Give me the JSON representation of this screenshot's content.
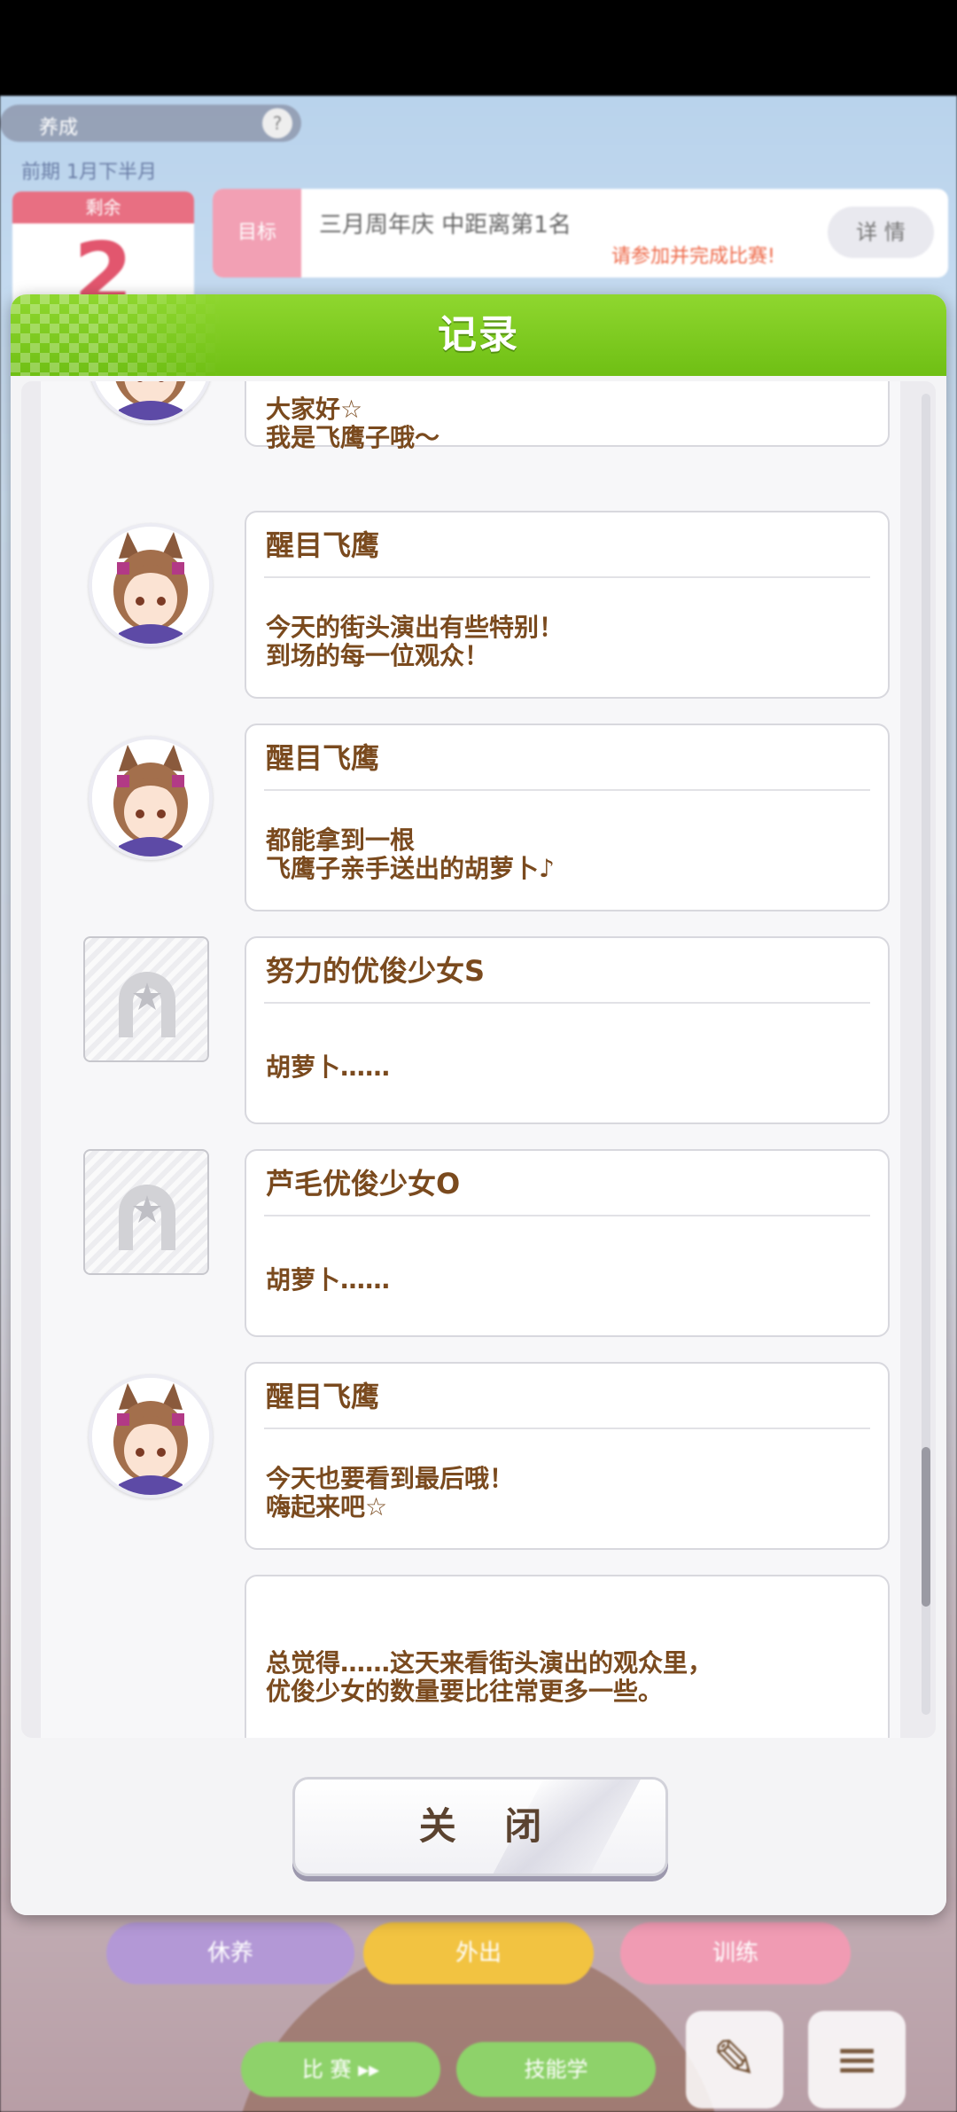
{
  "background": {
    "topbar_label": "养成",
    "topbar_help": "?",
    "subtext": "前期 1月下半月",
    "calendar_head": "剩余",
    "calendar_number": "2",
    "goal_tag": "目标",
    "goal_text": "三月周年庆 中距离第1名",
    "goal_sub": "请参加并完成比赛!",
    "goal_button": "详 情",
    "menu": [
      "休养",
      "外出",
      "训练"
    ],
    "buttons": [
      "比 赛 ▸▸",
      "技能学"
    ],
    "icons": [
      "notes-icon",
      "menu-icon"
    ]
  },
  "dialog": {
    "title": "记录",
    "close_label": "关 闭",
    "entries": [
      {
        "speaker": "",
        "lines": [
          "大家好☆",
          "我是飞鹰子哦～"
        ],
        "avatar": "character"
      },
      {
        "speaker": "醒目飞鹰",
        "lines": [
          "今天的街头演出有些特别！",
          "到场的每一位观众！"
        ],
        "avatar": "character"
      },
      {
        "speaker": "醒目飞鹰",
        "lines": [
          "都能拿到一根",
          "飞鹰子亲手送出的胡萝卜♪"
        ],
        "avatar": "character"
      },
      {
        "speaker": "努力的优俊少女S",
        "lines": [
          "胡萝卜……"
        ],
        "avatar": "placeholder"
      },
      {
        "speaker": "芦毛优俊少女O",
        "lines": [
          "胡萝卜……"
        ],
        "avatar": "placeholder"
      },
      {
        "speaker": "醒目飞鹰",
        "lines": [
          "今天也要看到最后哦！",
          "嗨起来吧☆"
        ],
        "avatar": "character"
      },
      {
        "speaker": "",
        "lines": [
          "总觉得……这天来看街头演出的观众里，",
          "优俊少女的数量要比往常更多一些。"
        ],
        "avatar": "none"
      }
    ]
  },
  "colors": {
    "header_green": "#7cc61f",
    "text_brown": "#7a4a1e",
    "panel": "#f4f4f6"
  }
}
